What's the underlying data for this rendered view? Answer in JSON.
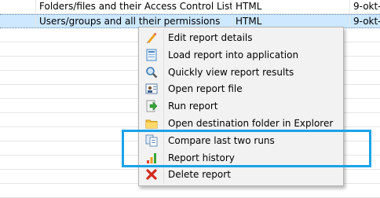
{
  "table": {
    "rows": [
      {
        "name": "Folders/files and their Access Control List",
        "format": "HTML",
        "date": "9-okt-"
      },
      {
        "name": "Users/groups and all their permissions",
        "format": "HTML",
        "date": "9-okt-"
      }
    ]
  },
  "context_menu": {
    "items": [
      {
        "label": "Edit report details",
        "icon": "pencil-icon"
      },
      {
        "label": "Load report into application",
        "icon": "load-report-icon"
      },
      {
        "label": "Quickly view report results",
        "icon": "magnifier-icon"
      },
      {
        "label": "Open report file",
        "icon": "report-file-icon"
      },
      {
        "label": "Run report",
        "icon": "run-arrow-icon"
      },
      {
        "label": "Open destination folder in Explorer",
        "icon": "folder-icon"
      },
      {
        "label": "Compare last two runs",
        "icon": "compare-icon"
      },
      {
        "label": "Report history",
        "icon": "bar-chart-icon"
      },
      {
        "label": "Delete report",
        "icon": "delete-x-icon"
      }
    ]
  },
  "colors": {
    "selection": "#cde8ff",
    "highlight_border": "#1aa3e8",
    "menu_background": "#f2f2f2"
  }
}
